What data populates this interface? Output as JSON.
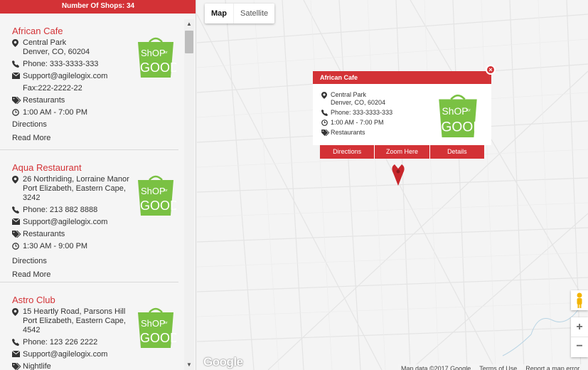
{
  "sidebar": {
    "shop_count_label": "Number Of Shops: 34",
    "shops": [
      {
        "name": "African Cafe",
        "address": "Central Park\nDenver, CO, 60204",
        "phone": "Phone: 333-3333-333",
        "email": "Support@agilelogix.com",
        "fax": "Fax:222-2222-22",
        "category": "Restaurants",
        "hours": "1:00 AM - 7:00 PM",
        "directions": "Directions",
        "read_more": "Read More"
      },
      {
        "name": "Aqua Restaurant",
        "address": "26 Northriding, Lorraine Manor\nPort Elizabeth, Eastern Cape,\n3242",
        "phone": "Phone: 213 882 8888",
        "email": "Support@agilelogix.com",
        "category": "Restaurants",
        "hours": "1:30 AM - 9:00 PM",
        "directions": "Directions",
        "read_more": "Read More"
      },
      {
        "name": "Astro Club",
        "address": "15 Heartly Road, Parsons Hill\nPort Elizabeth, Eastern Cape,\n4542",
        "phone": "Phone: 123 226 2222",
        "email": "Support@agilelogix.com",
        "category": "Nightlife"
      }
    ]
  },
  "map": {
    "type_map": "Map",
    "type_satellite": "Satellite",
    "zoom_in": "+",
    "zoom_out": "−",
    "google_logo": "Google",
    "attribution": {
      "data": "Map data ©2017 Google",
      "terms": "Terms of Use",
      "report": "Report a map error"
    }
  },
  "info_window": {
    "title": "African Cafe",
    "close": "×",
    "address": "Central Park\nDenver, CO, 60204",
    "phone": "Phone: 333-3333-333",
    "hours": "1:00 AM - 7:00 PM",
    "category": "Restaurants",
    "actions": {
      "directions": "Directions",
      "zoom": "Zoom Here",
      "details": "Details"
    }
  },
  "logo": {
    "line1": "ShOP",
    "line2": "GOOD",
    "small": "for"
  },
  "colors": {
    "brand_red": "#d33236",
    "logo_green": "#7ac143",
    "map_bg": "#f4f4f4"
  },
  "icons": [
    "map-pin-icon",
    "phone-icon",
    "envelope-icon",
    "tag-icon",
    "clock-icon",
    "marker-icon",
    "pegman-icon"
  ]
}
